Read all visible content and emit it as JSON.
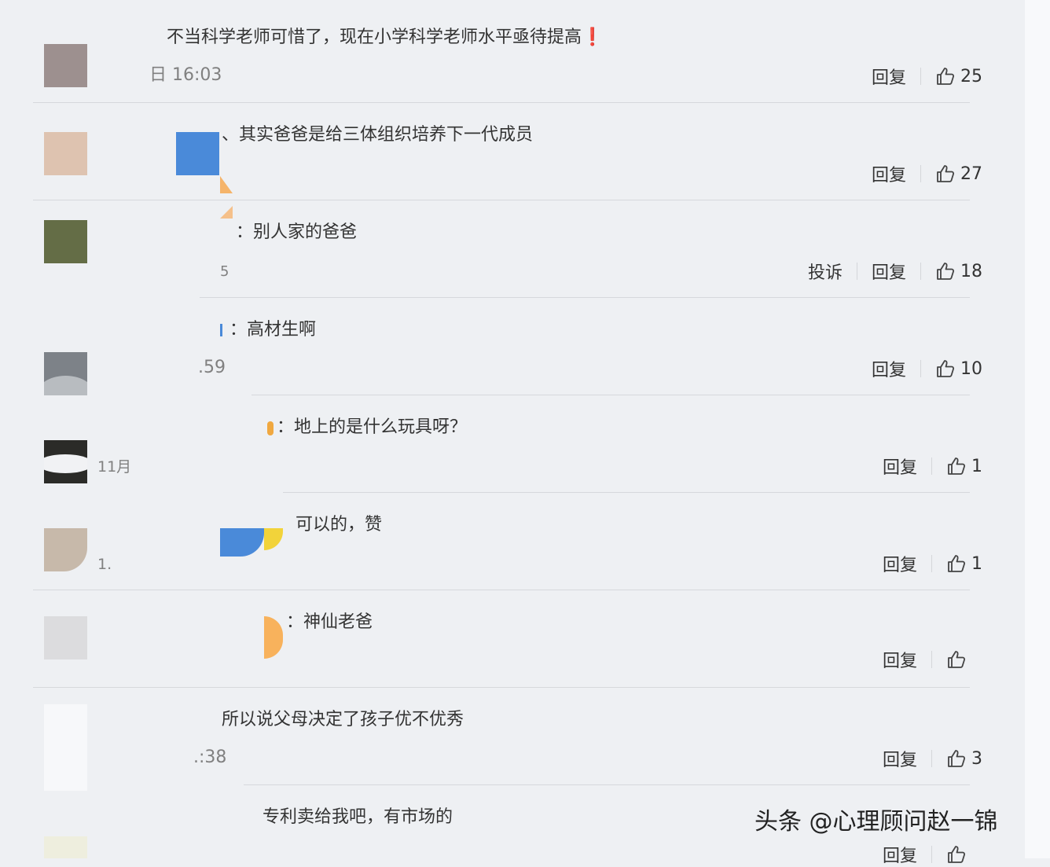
{
  "comments": [
    {
      "text": "不当科学老师可惜了，现在小学科学老师水平亟待提高❗",
      "time": "日 16:03",
      "actions": {
        "reply": "回复",
        "likes": "25"
      }
    },
    {
      "text": "、其实爸爸是给三体组织培养下一代成员",
      "time": "",
      "actions": {
        "reply": "回复",
        "likes": "27"
      }
    },
    {
      "text": "：别人家的爸爸",
      "time": "5",
      "actions": {
        "report": "投诉",
        "reply": "回复",
        "likes": "18"
      }
    },
    {
      "text": "：高材生啊",
      "time": ".59",
      "actions": {
        "reply": "回复",
        "likes": "10"
      }
    },
    {
      "text": "：地上的是什么玩具呀？",
      "time": "11月",
      "actions": {
        "reply": "回复",
        "likes": "1"
      }
    },
    {
      "text": "可以的，赞",
      "time": "1.",
      "actions": {
        "reply": "回复",
        "likes": "1"
      }
    },
    {
      "text": "：神仙老爸",
      "time": "",
      "actions": {
        "reply": "回复",
        "likes": ""
      }
    },
    {
      "text": "所以说父母决定了孩子优不优秀",
      "time": ".:38",
      "actions": {
        "reply": "回复",
        "likes": "3"
      }
    },
    {
      "text": "专利卖给我吧，有市场的",
      "time": "",
      "actions": {
        "reply": "回复",
        "likes": ""
      }
    }
  ],
  "watermark": "头条 @心理顾问赵一锦",
  "colors": {
    "background": "#eef0f3",
    "text": "#333333",
    "muted": "#808080",
    "divider": "#d6d8dc"
  },
  "avatars": [
    "#9d908f",
    "#dec3b0",
    "#646d46",
    "#7d8288",
    "#2b2b28",
    "#c7b9aa",
    "#dcdcde",
    "#f7f8fa",
    "#eeeede"
  ]
}
